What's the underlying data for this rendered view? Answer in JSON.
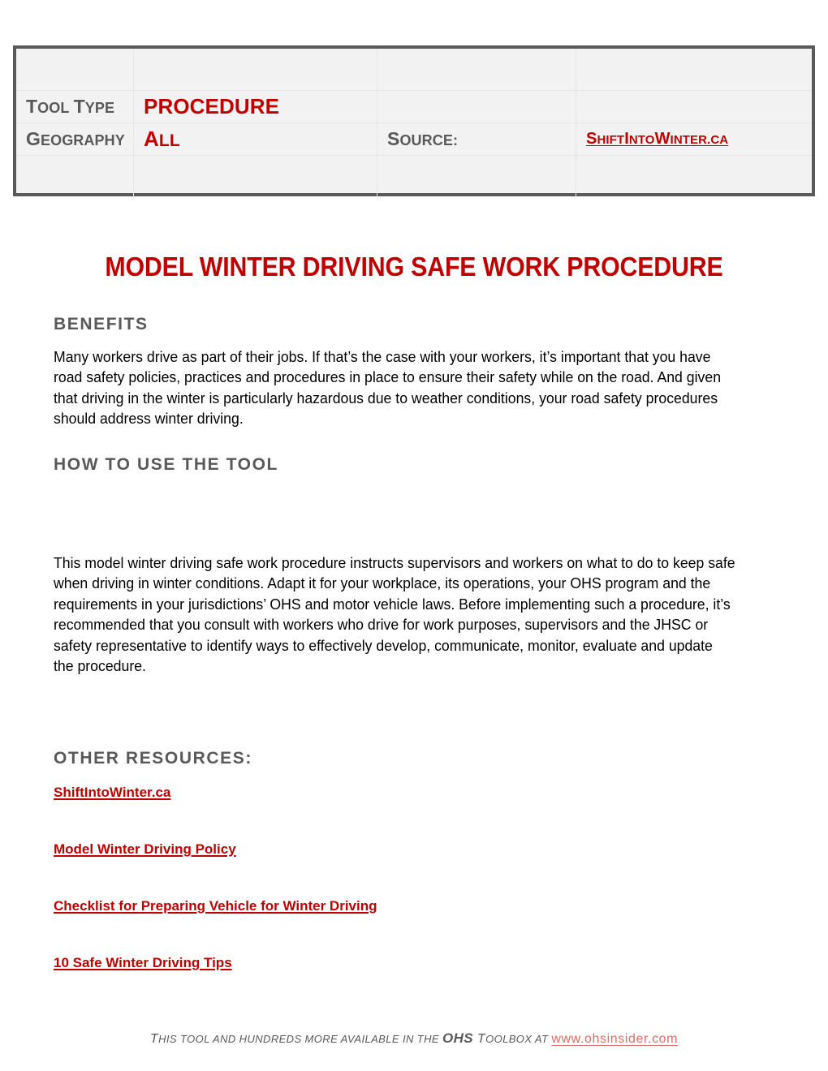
{
  "header_meta": {
    "rows": [
      {
        "label_cap": "T",
        "label_rest": "OOL ",
        "label_cap2": "T",
        "label_rest2": "YPE",
        "value": "PROCEDURE"
      },
      {
        "label_cap": "G",
        "label_rest": "EOGRAPHY",
        "value_cap": "A",
        "value_rest": "LL",
        "source_label_cap": "S",
        "source_label_rest": "OURCE:",
        "source_value": "ShiftIntoWinter.ca"
      }
    ],
    "tool_type_label_1_cap": "T",
    "tool_type_label_1_rest": "OOL",
    "tool_type_label_2_cap": "T",
    "tool_type_label_2_rest": "YPE",
    "tool_type_value": "PROCEDURE",
    "geography_label_cap": "G",
    "geography_label_rest": "EOGRAPHY",
    "geography_value_cap": "A",
    "geography_value_rest": "LL",
    "source_label_cap": "S",
    "source_label_rest": "OURCE:",
    "source_link_segments": [
      {
        "cap": "S",
        "rest": "HIFT"
      },
      {
        "cap": "I",
        "rest": "NTO"
      },
      {
        "cap": "W",
        "rest": "INTER.CA"
      }
    ]
  },
  "document": {
    "title": "MODEL WINTER DRIVING SAFE WORK PROCEDURE"
  },
  "sections": {
    "benefits": {
      "heading": "BENEFITS",
      "body": "Many workers drive as part of their jobs. If that’s the case with your workers, it’s important that you have road safety policies, practices and procedures in place to ensure their safety while on the road. And given that driving in the winter is particularly hazardous due to weather conditions, your road safety procedures should address winter driving."
    },
    "how_to_use": {
      "heading": "HOW TO USE THE TOOL",
      "body": "This model winter driving safe work procedure instructs supervisors and workers on what to do to keep safe when driving in winter conditions. Adapt it for your workplace, its operations, your OHS program and the requirements in your jurisdictions’ OHS and motor vehicle laws. Before implementing such a procedure, it’s recommended that you consult with workers who drive for work purposes, supervisors and the JHSC or safety representative to identify ways to effectively develop, communicate, monitor, evaluate and update the procedure."
    },
    "other_resources": {
      "heading": "OTHER RESOURCES:",
      "links": [
        "ShiftIntoWinter.ca",
        "Model Winter Driving Policy",
        "Checklist for Preparing Vehicle for Winter Driving",
        "10 Safe Winter Driving Tips"
      ]
    }
  },
  "footer": {
    "seg1_cap": "T",
    "seg1_rest": "HIS TOOL AND HUNDREDS MORE AVAILABLE IN THE ",
    "ohs": "OHS",
    "seg2_cap": " T",
    "seg2_rest": "OOLBOX AT ",
    "url": "www.ohsinsider.com"
  },
  "colors": {
    "brand_red": "#C00000",
    "heading_gray": "#595959",
    "meta_bg": "#F2F2F2",
    "meta_border": "#595959",
    "footer_url": "#E06C64"
  }
}
